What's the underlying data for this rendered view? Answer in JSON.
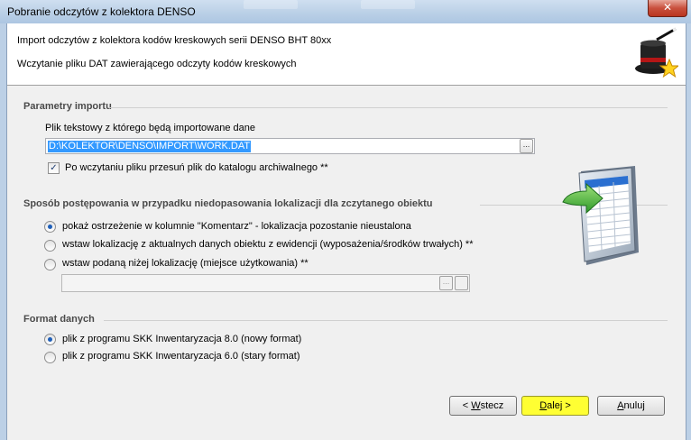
{
  "window": {
    "title": "Pobranie odczytów z kolektora DENSO",
    "close_glyph": "✕"
  },
  "header": {
    "title": "Import odczytów z kolektora kodów kreskowych serii DENSO BHT 80xx",
    "subtitle": "Wczytanie pliku DAT zawierającego odczyty kodów kreskowych",
    "icon": "magic-hat-icon"
  },
  "import_params": {
    "section_title": "Parametry importu",
    "file_label": "Plik tekstowy z którego będą importowane dane",
    "file_value": "D:\\KOLEKTOR\\DENSO\\IMPORT\\WORK.DAT",
    "browse_glyph": "...",
    "move_checkbox": {
      "label": "Po wczytaniu pliku przesuń plik do katalogu archiwalnego **",
      "checked": true
    }
  },
  "location": {
    "section_title": "Sposób postępowania w przypadku niedopasowania lokalizacji dla zczytanego obiektu",
    "options": [
      {
        "label": "pokaż ostrzeżenie w kolumnie \"Komentarz\" - lokalizacja pozostanie nieustalona",
        "selected": true
      },
      {
        "label": "wstaw lokalizację z aktualnych danych obiektu z ewidencji (wyposażenia/środków trwałych)  **",
        "selected": false
      },
      {
        "label": "wstaw podaną niżej lokalizację  (miejsce użytkowania) **",
        "selected": false
      }
    ],
    "location_value": "",
    "browse_glyph": "..."
  },
  "format": {
    "section_title": "Format danych",
    "options": [
      {
        "label": "plik z programu SKK Inwentaryzacja 8.0 (nowy format)",
        "selected": true
      },
      {
        "label": "plik z programu SKK Inwentaryzacja 6.0 (stary format)",
        "selected": false
      }
    ]
  },
  "buttons": {
    "back": {
      "prefix": "< ",
      "mnemonic": "W",
      "rest": "stecz"
    },
    "next": {
      "mnemonic": "D",
      "rest": "alej",
      "suffix": " >"
    },
    "cancel": {
      "mnemonic": "A",
      "rest": "nuluj"
    }
  },
  "colors": {
    "highlight": "#ffff33",
    "selection": "#3399ff"
  },
  "illustration": "spreadsheet-import-icon"
}
